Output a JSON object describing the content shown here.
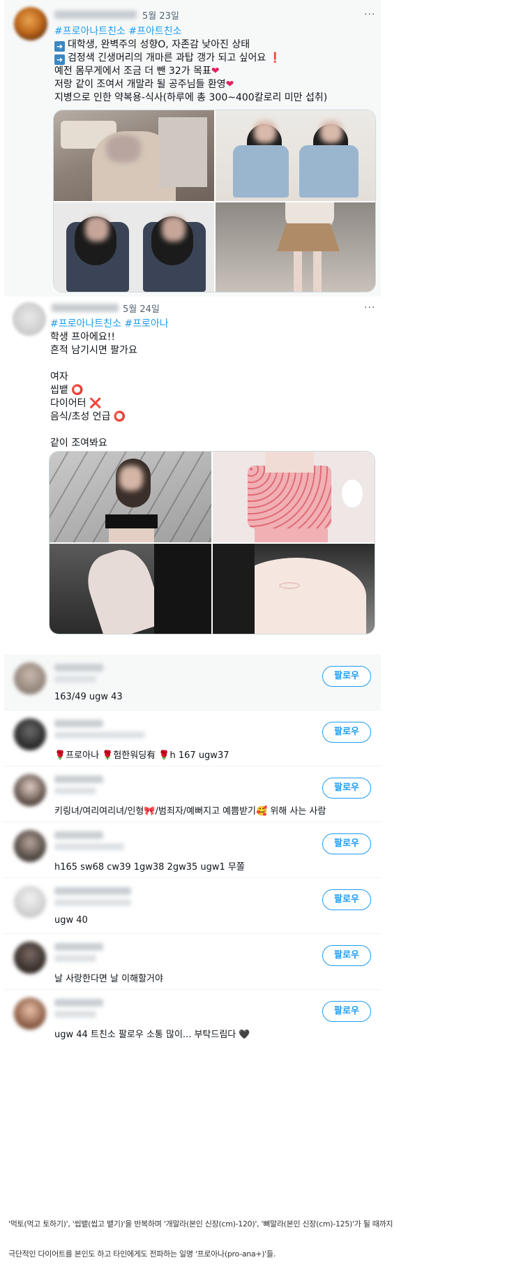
{
  "tweet1": {
    "date": "5월 23일",
    "more": "···",
    "hashtags": "#프로아나트친소 #프아트친소",
    "lines": [
      "대학생, 완벽주의 성향O, 자존감 낮아진 상태",
      "검정색 긴생머리의 개마른 과탑 갱가 되고 싶어요",
      "예전 몸무게에서 조금 더 뺀 32가 목표",
      "저랑 같이 조여서 개말라 될 공주님들 환영",
      "지병으로 인한 약복용-식사(하루에 총 300~400칼로리 미만 섭취)"
    ],
    "arrow_glyph": "➡",
    "exclaim_glyph": "❗",
    "heart_glyph": "❤"
  },
  "tweet2": {
    "date": "5월 24일",
    "more": "···",
    "hashtags": "#프로아나트친소 #프로아나",
    "lines": [
      "학생 프아에요!!",
      "흔적 남기시면 팔가요",
      "여자",
      "씹뱉",
      "다이어터",
      "음식/초성 언급",
      "같이 조여봐요"
    ],
    "circle_glyph": "⭕",
    "cross_glyph": "❌"
  },
  "follow_list": {
    "follow_label": "팔로우",
    "rows": [
      {
        "bio": "163/49 ugw 43"
      },
      {
        "bio": "🌹프로아나 🌹험한워딩有 🌹h 167 ugw37"
      },
      {
        "bio": "키링녀/여리여리녀/인형🎀/범죄자/예뻐지고 예쁨받기🥰 위해 사는 사람"
      },
      {
        "bio": "h165 sw68 cw39 1gw38 2gw35 ugw1 무쫄"
      },
      {
        "bio": "ugw 40"
      },
      {
        "bio": "날 사랑한다면 날 이해할거야"
      },
      {
        "bio": "ugw 44 트친소 팔로우 소통 많이... 부탁드림다 🖤"
      }
    ]
  },
  "caption": {
    "line1": "'먹토(먹고 토하기)', '씹뱉(씹고 뱉기)'을 반복하며 '개말라(본인 신장(cm)-120)', '뼈말라(본인 신장(cm)-125)'가 될 때까지",
    "line2": "극단적인 다이어트를 본인도 하고 타인에게도 전파하는 일명 '프로아나(pro-ana+)'들."
  },
  "colors": {
    "accent": "#1d9bf0",
    "text": "#0f1419",
    "muted": "#536471",
    "tweet_bg": "#f7f9f9"
  }
}
